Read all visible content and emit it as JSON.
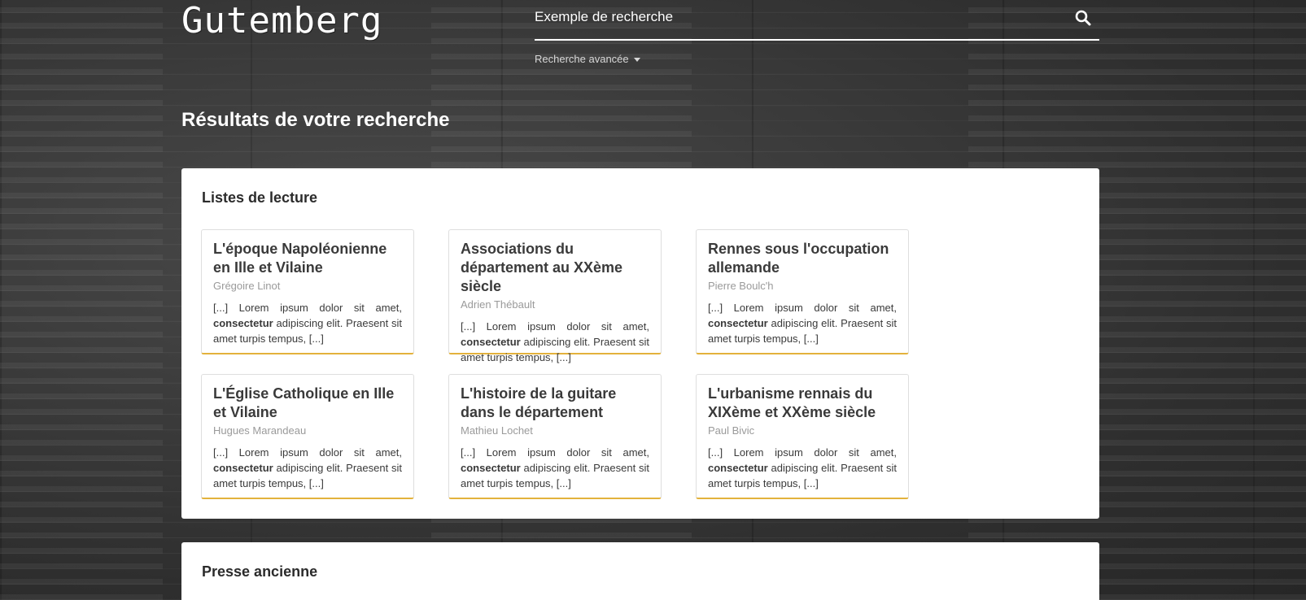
{
  "header": {
    "logo": "Gutemberg",
    "search_placeholder": "Exemple de recherche",
    "advanced_search_label": "Recherche avancée"
  },
  "results_title": "Résultats de votre recherche",
  "reading_lists": {
    "title": "Listes de lecture",
    "cards": [
      {
        "title": "L'époque Napoléonienne en Ille et Vilaine",
        "author": "Grégoire Linot",
        "excerpt_before": "[...] Lorem ipsum dolor sit amet,",
        "excerpt_bold": "consectetur",
        "excerpt_after": "adipiscing elit. Praesent sit amet turpis tempus, [...]"
      },
      {
        "title": "Associations du département au XXème siècle",
        "author": "Adrien Thébault",
        "excerpt_before": "[...] Lorem ipsum dolor sit amet,",
        "excerpt_bold": "consectetur",
        "excerpt_after": "adipiscing elit. Praesent sit amet turpis tempus, [...]"
      },
      {
        "title": "Rennes sous l'occupation allemande",
        "author": "Pierre Boulc'h",
        "excerpt_before": "[...] Lorem ipsum dolor sit amet,",
        "excerpt_bold": "consectetur",
        "excerpt_after": "adipiscing elit. Praesent sit amet turpis tempus, [...]"
      },
      {
        "title": "L'Église Catholique en Ille et Vilaine",
        "author": "Hugues Marandeau",
        "excerpt_before": "[...] Lorem ipsum dolor sit amet,",
        "excerpt_bold": "consectetur",
        "excerpt_after": "adipiscing elit. Praesent sit amet turpis tempus, [...]"
      },
      {
        "title": "L'histoire de la guitare dans le département",
        "author": "Mathieu Lochet",
        "excerpt_before": "[...] Lorem ipsum dolor sit amet,",
        "excerpt_bold": "consectetur",
        "excerpt_after": "adipiscing elit. Praesent sit amet turpis tempus, [...]"
      },
      {
        "title": "L'urbanisme rennais du XIXème et XXème siècle",
        "author": "Paul Bivic",
        "excerpt_before": "[...] Lorem ipsum dolor sit amet,",
        "excerpt_bold": "consectetur",
        "excerpt_after": "adipiscing elit. Praesent sit amet turpis tempus, [...]"
      }
    ]
  },
  "old_press": {
    "title": "Presse ancienne"
  },
  "colors": {
    "card_accent": "#e3b23c",
    "panel_bg": "#ffffff",
    "page_bg": "#3a3a3a"
  },
  "icons": {
    "search": "search-icon",
    "advanced_caret": "caret-down-icon"
  }
}
